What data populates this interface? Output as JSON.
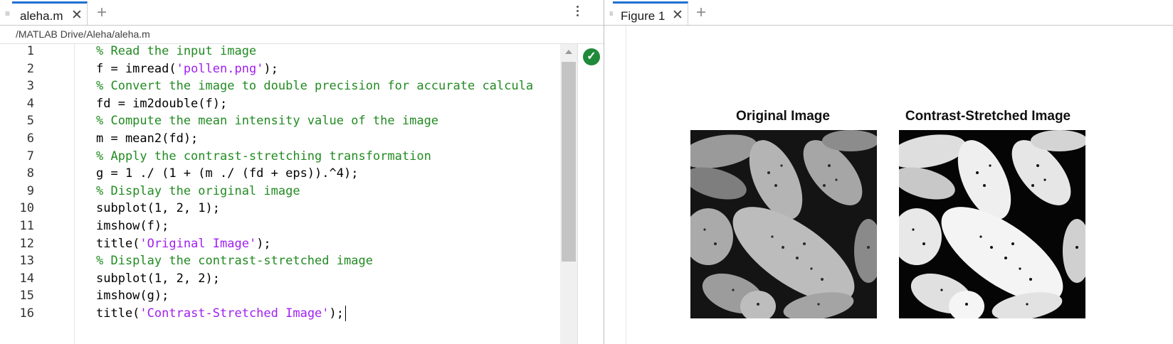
{
  "editor": {
    "tab_label": "aleha.m",
    "close_glyph": "✕",
    "add_glyph": "+",
    "file_path": "/MATLAB Drive/Aleha/aleha.m",
    "status_icon": "check-circle-icon",
    "lines": [
      {
        "n": "1",
        "parts": [
          {
            "t": "% Read the input image",
            "k": "comment"
          }
        ]
      },
      {
        "n": "2",
        "parts": [
          {
            "t": "f = imread(",
            "k": "plain"
          },
          {
            "t": "'pollen.png'",
            "k": "str"
          },
          {
            "t": ");",
            "k": "plain"
          }
        ]
      },
      {
        "n": "3",
        "parts": [
          {
            "t": "% Convert the image to double precision for accurate calcula",
            "k": "comment"
          }
        ]
      },
      {
        "n": "4",
        "parts": [
          {
            "t": "fd = im2double(f);",
            "k": "plain"
          }
        ]
      },
      {
        "n": "5",
        "parts": [
          {
            "t": "% Compute the mean intensity value of the image",
            "k": "comment"
          }
        ]
      },
      {
        "n": "6",
        "parts": [
          {
            "t": "m = mean2(fd);",
            "k": "plain"
          }
        ]
      },
      {
        "n": "7",
        "parts": [
          {
            "t": "% Apply the contrast-stretching transformation",
            "k": "comment"
          }
        ]
      },
      {
        "n": "8",
        "parts": [
          {
            "t": "g = 1 ./ (1 + (m ./ (fd + eps)).^4);",
            "k": "plain"
          }
        ]
      },
      {
        "n": "9",
        "parts": [
          {
            "t": "% Display the original image",
            "k": "comment"
          }
        ]
      },
      {
        "n": "10",
        "parts": [
          {
            "t": "subplot(1, 2, 1);",
            "k": "plain"
          }
        ]
      },
      {
        "n": "11",
        "parts": [
          {
            "t": "imshow(f);",
            "k": "plain"
          }
        ]
      },
      {
        "n": "12",
        "parts": [
          {
            "t": "title(",
            "k": "plain"
          },
          {
            "t": "'Original Image'",
            "k": "str"
          },
          {
            "t": ");",
            "k": "plain"
          }
        ]
      },
      {
        "n": "13",
        "parts": [
          {
            "t": "% Display the contrast-stretched image",
            "k": "comment"
          }
        ]
      },
      {
        "n": "14",
        "parts": [
          {
            "t": "subplot(1, 2, 2);",
            "k": "plain"
          }
        ]
      },
      {
        "n": "15",
        "parts": [
          {
            "t": "imshow(g);",
            "k": "plain"
          }
        ]
      },
      {
        "n": "16",
        "parts": [
          {
            "t": "title(",
            "k": "plain"
          },
          {
            "t": "'Contrast-Stretched Image'",
            "k": "str"
          },
          {
            "t": ");",
            "k": "plain"
          }
        ]
      }
    ]
  },
  "figure": {
    "tab_label": "Figure 1",
    "close_glyph": "✕",
    "add_glyph": "+",
    "axes": [
      {
        "title": "Original Image",
        "image": "pollen grains grayscale micrograph"
      },
      {
        "title": "Contrast-Stretched Image",
        "image": "pollen grains contrast-stretched micrograph"
      }
    ]
  },
  "colors": {
    "comment": "#228b22",
    "string": "#a020f0",
    "tab_accent": "#1f6fd0",
    "status_ok": "#1f8a3a"
  }
}
